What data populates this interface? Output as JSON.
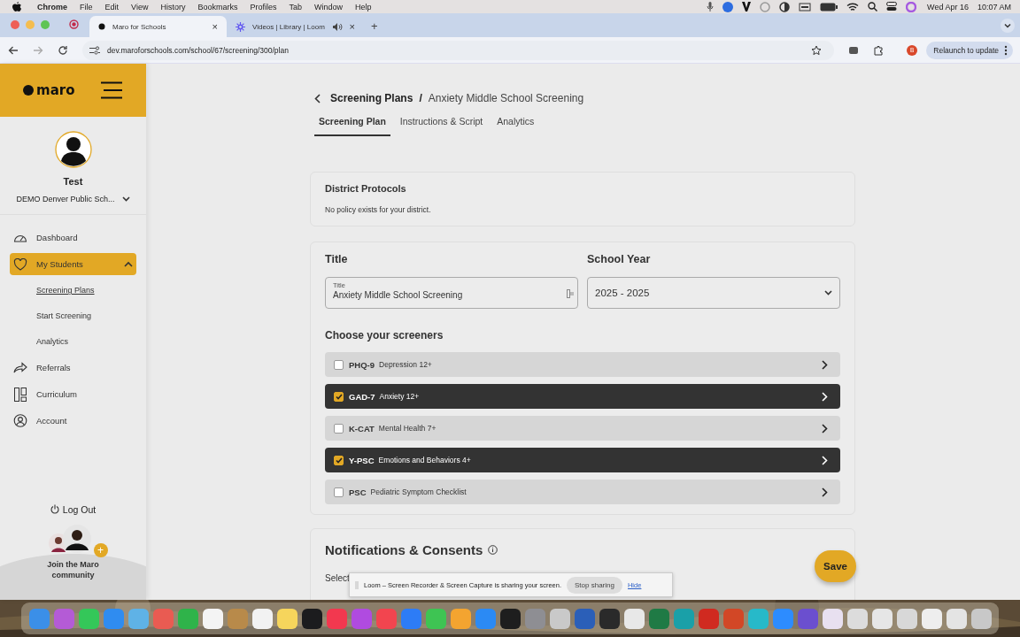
{
  "menu_bar": {
    "app": "Chrome",
    "items": [
      "File",
      "Edit",
      "View",
      "History",
      "Bookmarks",
      "Profiles",
      "Tab",
      "Window",
      "Help"
    ],
    "date": "Wed Apr 16",
    "time": "10:07 AM"
  },
  "browser": {
    "tabs": [
      {
        "title": "Maro for Schools",
        "selected": true,
        "close": "×"
      },
      {
        "title": "Videos | Library | Loom",
        "selected": false,
        "close": "×"
      }
    ],
    "new_tab": "+",
    "url": "dev.maroforschools.com/school/67/screening/300/plan",
    "profile": "B",
    "relaunch": "Relaunch to update"
  },
  "sidebar": {
    "logo": "maro",
    "user_name": "Test",
    "district": "DEMO Denver Public Sch...",
    "nav": [
      {
        "label": "Dashboard",
        "selected": false
      },
      {
        "label": "My Students",
        "selected": true,
        "expanded": true,
        "children": [
          {
            "label": "Screening Plans",
            "selected": true
          },
          {
            "label": "Start Screening",
            "selected": false
          },
          {
            "label": "Analytics",
            "selected": false
          }
        ]
      },
      {
        "label": "Referrals",
        "selected": false
      },
      {
        "label": "Curriculum",
        "selected": false
      },
      {
        "label": "Account",
        "selected": false
      }
    ],
    "logout": "Log Out",
    "community": "Join the Maro community",
    "community_plus": "+"
  },
  "breadcrumb": {
    "parent": "Screening Plans",
    "separator": "/",
    "current": "Anxiety Middle School Screening"
  },
  "tabs": [
    {
      "label": "Screening Plan",
      "selected": true
    },
    {
      "label": "Instructions & Script",
      "selected": false
    },
    {
      "label": "Analytics",
      "selected": false
    }
  ],
  "district_protocols": {
    "heading": "District Protocols",
    "text": "No policy exists for your district."
  },
  "form": {
    "title_heading": "Title",
    "title_field": {
      "label": "Title",
      "value": "Anxiety Middle School Screening"
    },
    "year_heading": "School Year",
    "year_value": "2025 - 2025",
    "screeners_heading": "Choose your screeners",
    "screeners": [
      {
        "code": "PHQ-9",
        "desc": "Depression 12+",
        "checked": false
      },
      {
        "code": "GAD-7",
        "desc": "Anxiety 12+",
        "checked": true
      },
      {
        "code": "K-CAT",
        "desc": "Mental Health 7+",
        "checked": false
      },
      {
        "code": "Y-PSC",
        "desc": "Emotions and Behaviors 4+",
        "checked": true
      },
      {
        "code": "PSC",
        "desc": "Pediatric Symptom Checklist",
        "checked": false
      }
    ]
  },
  "notifications": {
    "heading": "Notifications & Consents",
    "text": "Select"
  },
  "save": "Save",
  "loom_bar": {
    "text": "Loom – Screen Recorder & Screen Capture is sharing your screen.",
    "stop": "Stop sharing",
    "hide": "Hide"
  },
  "dock": {
    "apps": [
      {
        "color": "#3b8fe8"
      },
      {
        "color": "#b45bd6"
      },
      {
        "color": "#34c759"
      },
      {
        "color": "#2f8cf0"
      },
      {
        "color": "#5fb2e6"
      },
      {
        "color": "#e95b52"
      },
      {
        "color": "#2fb34a"
      },
      {
        "color": "#f4f4f4"
      },
      {
        "color": "#b88a4a"
      },
      {
        "color": "#f2f2f2"
      },
      {
        "color": "#f6d55c"
      },
      {
        "color": "#1c1c1e"
      },
      {
        "color": "#f2384f"
      },
      {
        "color": "#b04be0"
      },
      {
        "color": "#f2454f"
      },
      {
        "color": "#2d7cf6"
      },
      {
        "color": "#3ec453"
      },
      {
        "color": "#f3a430"
      },
      {
        "color": "#2b8af4"
      },
      {
        "color": "#1e1e1e"
      },
      {
        "color": "#8e8e93"
      },
      {
        "color": "#c9c9c9"
      },
      {
        "color": "#2b5fb8"
      },
      {
        "color": "#2a2a2a"
      },
      {
        "color": "#e8e8e8"
      },
      {
        "color": "#1f7a45"
      },
      {
        "color": "#1aa0a8"
      },
      {
        "color": "#d02a20"
      },
      {
        "color": "#d24726"
      },
      {
        "color": "#27b9c9"
      },
      {
        "color": "#2d8cff"
      },
      {
        "color": "#6b4fcf"
      },
      {
        "color": "#e8e0f0"
      },
      {
        "color": "#dcdcdc"
      },
      {
        "color": "#e6e6e6"
      },
      {
        "color": "#d8d8d8"
      },
      {
        "color": "#eeeeee"
      },
      {
        "color": "#e4e4e4"
      },
      {
        "color": "#c8c8c8"
      }
    ]
  }
}
